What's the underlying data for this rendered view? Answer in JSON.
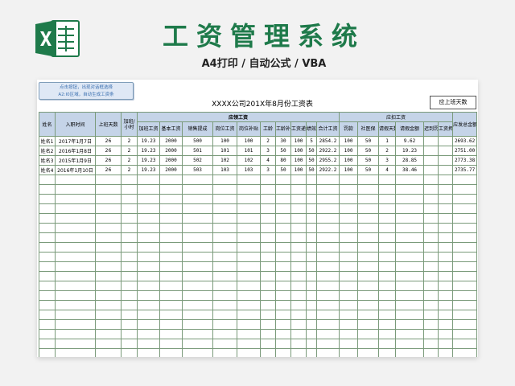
{
  "header": {
    "title": "工资管理系统",
    "subtitle": "A4打印 / 自动公式 / VBA",
    "brand_color": "#1e7a4a"
  },
  "macro_button": {
    "line1": "点击按钮，出现对话框选择",
    "line2": "A2:I0区域，自动生成工资条"
  },
  "sheet": {
    "title": "XXXX公司201X年8月份工资表",
    "days_button": "应上班天数"
  },
  "table": {
    "group_labels": {
      "payable": "应领工资",
      "deduction": "应扣工资"
    },
    "columns": [
      "姓名",
      "入职时间",
      "上班天数",
      "加班/小时",
      "加班工资",
      "基本工资",
      "销售提成",
      "岗位工资",
      "岗位补贴",
      "工龄",
      "工龄补贴",
      "工资递款",
      "绩效",
      "合计工资",
      "罚款",
      "社医保",
      "请假天数",
      "请假金额",
      "迟到罚款",
      "工资押金",
      "应发总金额"
    ],
    "rows": [
      [
        "姓名1",
        "2017年1月7日",
        "26",
        "2",
        "19.23",
        "2000",
        "500",
        "100",
        "100",
        "2",
        "30",
        "100",
        "5",
        "2854.2",
        "100",
        "50",
        "1",
        "9.62",
        "",
        "",
        "2693.62"
      ],
      [
        "姓名2",
        "2016年1月8日",
        "26",
        "2",
        "19.23",
        "2000",
        "501",
        "101",
        "101",
        "3",
        "50",
        "100",
        "50",
        "2922.2",
        "100",
        "50",
        "2",
        "19.23",
        "",
        "",
        "2751.00"
      ],
      [
        "姓名3",
        "2015年1月9日",
        "26",
        "2",
        "19.23",
        "2000",
        "502",
        "102",
        "102",
        "4",
        "80",
        "100",
        "50",
        "2955.2",
        "100",
        "50",
        "3",
        "28.85",
        "",
        "",
        "2773.38"
      ],
      [
        "姓名4",
        "2016年1月10日",
        "26",
        "2",
        "19.23",
        "2000",
        "503",
        "103",
        "103",
        "3",
        "50",
        "100",
        "50",
        "2922.2",
        "100",
        "50",
        "4",
        "38.46",
        "",
        "",
        "2735.77"
      ]
    ],
    "empty_rows": 20
  }
}
